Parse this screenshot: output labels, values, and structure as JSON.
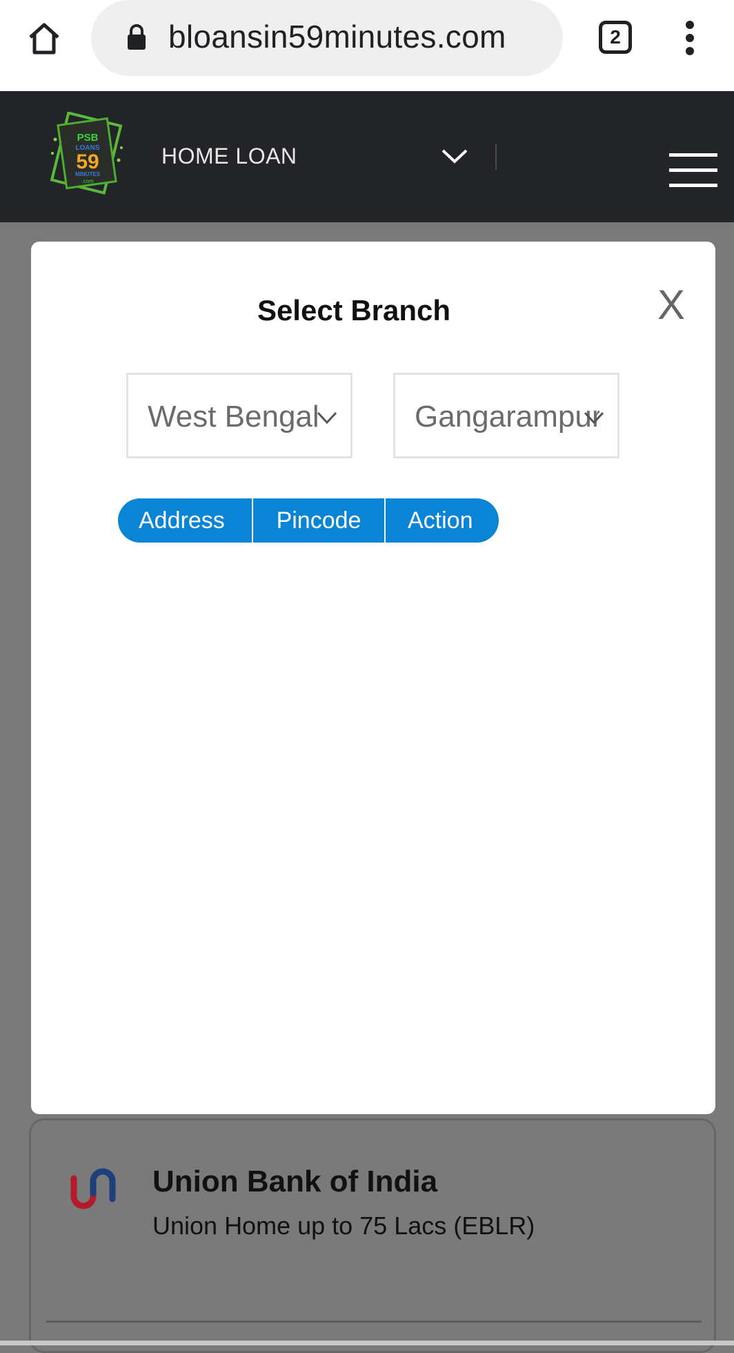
{
  "browser": {
    "url": "bloansin59minutes.com",
    "tab_count": "2"
  },
  "header": {
    "logo_text": "PSB LOANS 59 MINUTES .com",
    "loan_type": "HOME LOAN"
  },
  "modal": {
    "title": "Select Branch",
    "close_label": "X",
    "state_select_value": "West Bengal",
    "city_select_value": "Gangarampur",
    "table_headers": [
      "Address",
      "Pincode",
      "Action"
    ]
  },
  "background_card": {
    "bank_name": "Union Bank of India",
    "product": "Union Home up to 75 Lacs (EBLR)"
  },
  "colors": {
    "header_bg": "#222427",
    "table_header_bg": "#0a84d4",
    "overlay": "#7a7a7a"
  }
}
